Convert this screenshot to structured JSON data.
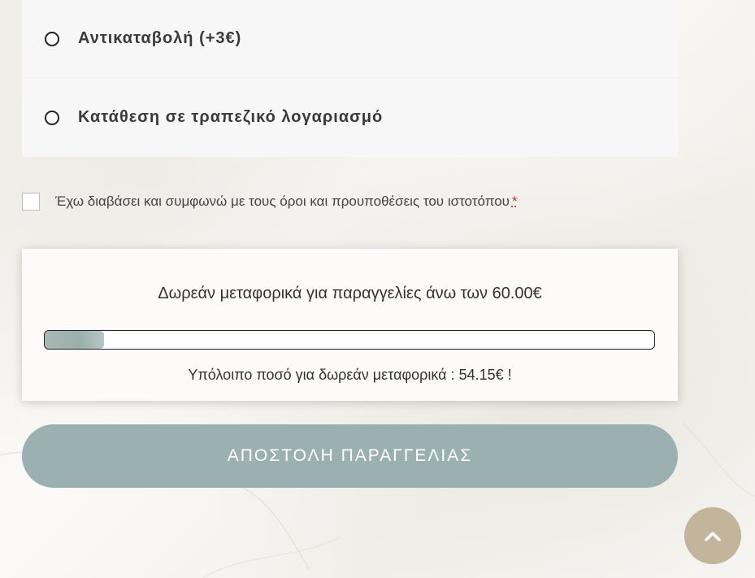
{
  "payment": {
    "options": [
      {
        "label": "Αντικαταβολή (+3€)",
        "selected": false
      },
      {
        "label": "Κατάθεση σε τραπεζικό λογαριασμό",
        "selected": false
      }
    ]
  },
  "terms": {
    "label": "Έχω διαβάσει και συμφωνώ με τους όροι και προυποθέσεις του ιστοτόπου",
    "required_mark": "*",
    "checked": false
  },
  "free_shipping": {
    "title": "Δωρεάν μεταφορικά για παραγγελίες άνω των 60.00€",
    "remaining_text": "Υπόλοιπο ποσό για δωρεάν μεταφορικά : 54.15€ !",
    "progress_fraction": 0.0975
  },
  "submit": {
    "label": "ΑΠΟΣΤΟΛΗ ΠΑΡΑΓΓΕΛΙΑΣ"
  },
  "scroll_top": {
    "icon": "chevron-up-icon"
  },
  "colors": {
    "submit_bg": "#9bb1b1",
    "scroll_top_bg": "#c2b59b",
    "progress_fill": "#9aafad",
    "required": "#c0392b"
  }
}
